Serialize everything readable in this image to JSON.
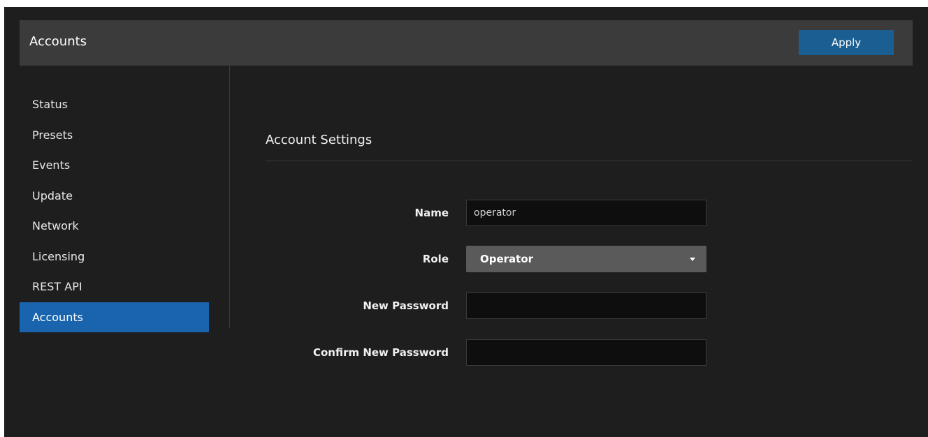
{
  "header": {
    "title": "Accounts",
    "apply_label": "Apply"
  },
  "sidebar": {
    "items": [
      {
        "label": "Status"
      },
      {
        "label": "Presets"
      },
      {
        "label": "Events"
      },
      {
        "label": "Update"
      },
      {
        "label": "Network"
      },
      {
        "label": "Licensing"
      },
      {
        "label": "REST API"
      },
      {
        "label": "Accounts",
        "active": true
      }
    ]
  },
  "main": {
    "section_title": "Account Settings",
    "fields": {
      "name": {
        "label": "Name",
        "value": "operator"
      },
      "role": {
        "label": "Role",
        "value": "Operator"
      },
      "new_password": {
        "label": "New Password",
        "value": ""
      },
      "confirm_password": {
        "label": "Confirm New Password",
        "value": ""
      }
    }
  },
  "colors": {
    "accent": "#1a64ad",
    "apply_button": "#1b5e91",
    "background": "#1e1e1e",
    "header": "#3b3b3b"
  },
  "icons": {
    "role_dropdown": "chevron-down-icon"
  }
}
